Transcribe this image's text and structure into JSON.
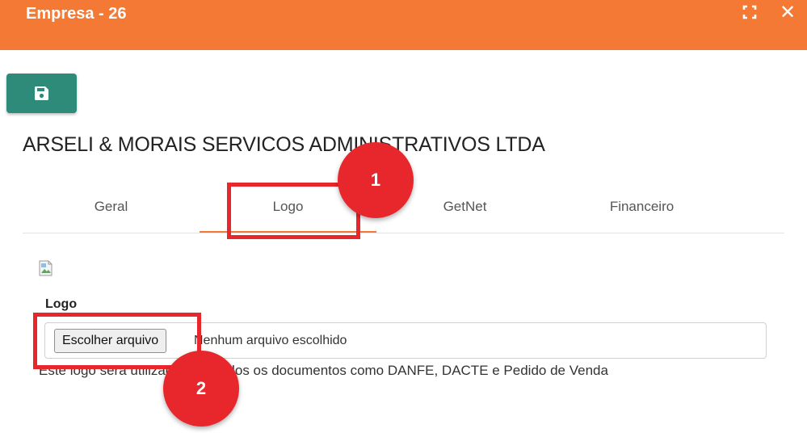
{
  "window": {
    "title": "Empresa - 26",
    "maximize_icon": "maximize-icon",
    "close_icon": "close-icon",
    "close_glyph": "✕"
  },
  "toolbar": {
    "save_icon": "save-icon"
  },
  "company": {
    "name": "ARSELI & MORAIS SERVICOS ADMINISTRATIVOS LTDA"
  },
  "tabs": [
    {
      "label": "Geral",
      "active": false
    },
    {
      "label": "Logo",
      "active": true
    },
    {
      "label": "GetNet",
      "active": false
    },
    {
      "label": "Financeiro",
      "active": false
    }
  ],
  "logo_section": {
    "image_icon": "broken-image-icon",
    "label": "Logo",
    "file_button_label": "Escolher arquivo",
    "file_status": "Nenhum arquivo escolhido",
    "help_text": "Este logo será utilizado para todos os documentos como DANFE, DACTE e Pedido de Venda"
  },
  "annotations": [
    {
      "number": "1"
    },
    {
      "number": "2"
    }
  ],
  "colors": {
    "titlebar": "#f47935",
    "save_button": "#2e8b7a",
    "annotation": "#e8272c",
    "active_tab_underline": "#f47935"
  }
}
